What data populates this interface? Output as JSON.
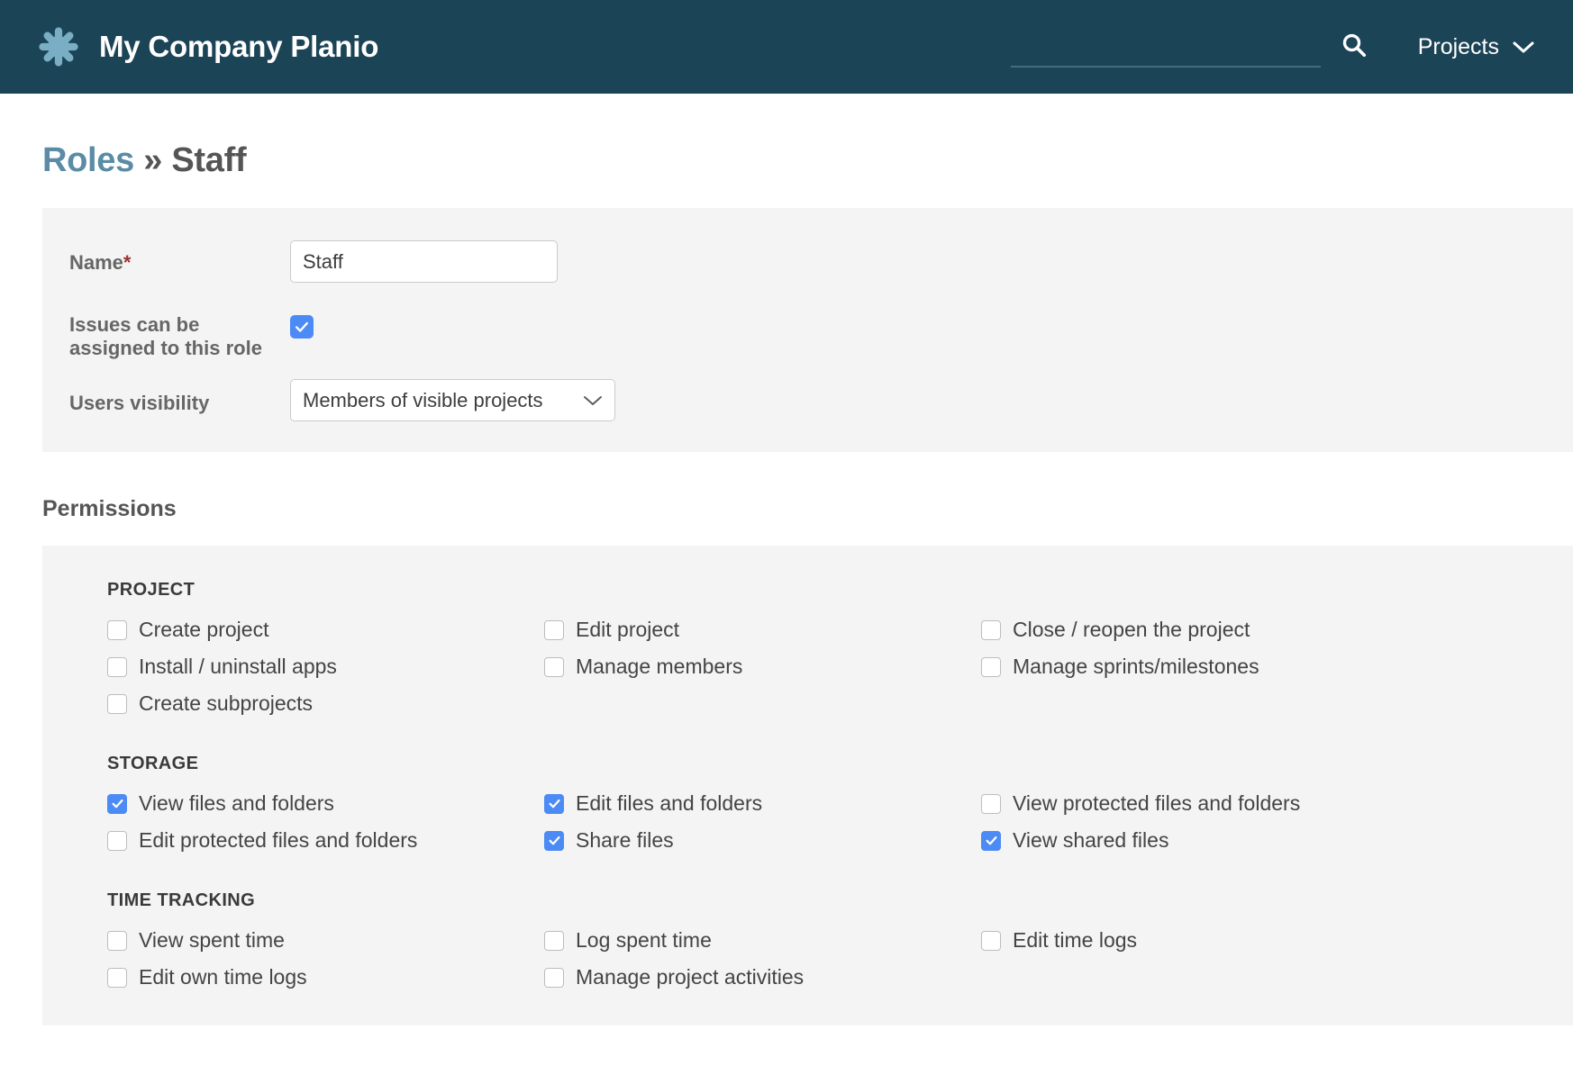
{
  "header": {
    "brand_title": "My Company Planio",
    "logo_icon": "asterisk-flower-icon",
    "search_icon": "search-icon",
    "search_value": "",
    "search_placeholder": "",
    "projects_label": "Projects",
    "projects_chevron_icon": "chevron-down-icon",
    "background_color": "#1c4457",
    "logo_color": "#7aaec4"
  },
  "breadcrumb": {
    "parent": "Roles",
    "separator": "»",
    "current": "Staff",
    "link_color": "#5b8ca6"
  },
  "form": {
    "name": {
      "label": "Name",
      "required_marker": "*",
      "value": "Staff",
      "placeholder": ""
    },
    "assignable": {
      "label": "Issues can be assigned to this role",
      "checked": true
    },
    "users_visibility": {
      "label": "Users visibility",
      "selected": "Members of visible projects",
      "chevron_icon": "chevron-down-icon"
    }
  },
  "permissions": {
    "heading": "Permissions",
    "checked_color": "#4c8bf5",
    "groups": [
      {
        "title": "PROJECT",
        "items": [
          {
            "label": "Create project",
            "checked": false
          },
          {
            "label": "Edit project",
            "checked": false
          },
          {
            "label": "Close / reopen the project",
            "checked": false
          },
          {
            "label": "Install / uninstall apps",
            "checked": false
          },
          {
            "label": "Manage members",
            "checked": false
          },
          {
            "label": "Manage sprints/milestones",
            "checked": false
          },
          {
            "label": "Create subprojects",
            "checked": false
          }
        ]
      },
      {
        "title": "STORAGE",
        "items": [
          {
            "label": "View files and folders",
            "checked": true
          },
          {
            "label": "Edit files and folders",
            "checked": true
          },
          {
            "label": "View protected files and folders",
            "checked": false
          },
          {
            "label": "Edit protected files and folders",
            "checked": false
          },
          {
            "label": "Share files",
            "checked": true
          },
          {
            "label": "View shared files",
            "checked": true
          }
        ]
      },
      {
        "title": "TIME TRACKING",
        "items": [
          {
            "label": "View spent time",
            "checked": false
          },
          {
            "label": "Log spent time",
            "checked": false
          },
          {
            "label": "Edit time logs",
            "checked": false
          },
          {
            "label": "Edit own time logs",
            "checked": false
          },
          {
            "label": "Manage project activities",
            "checked": false
          }
        ]
      }
    ]
  }
}
